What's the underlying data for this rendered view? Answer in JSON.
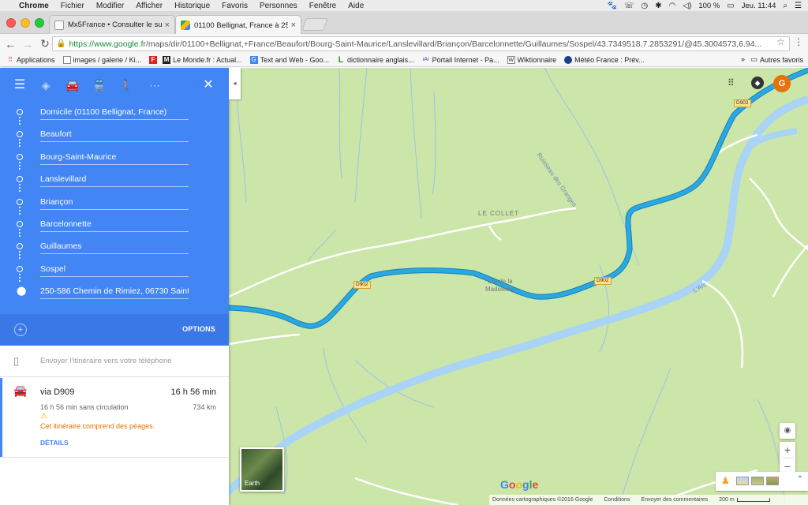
{
  "menubar": {
    "items": [
      "Chrome",
      "Fichier",
      "Modifier",
      "Afficher",
      "Historique",
      "Favoris",
      "Personnes",
      "Fenêtre",
      "Aide"
    ],
    "battery": "100 %",
    "clock": "Jeu. 11:44"
  },
  "tabs": [
    {
      "title": "Mx5France • Consulter le sujet",
      "active": false
    },
    {
      "title": "01100 Bellignat, France à 250",
      "active": true
    }
  ],
  "address_bar": {
    "url_host": "https://www.google.fr",
    "url_path": "/maps/dir/01100+Bellignat,+France/Beaufort/Bourg-Saint-Maurice/Lanslevillard/Briançon/Barcelonnette/Guillaumes/Sospel/43.7349518,7.2853291/@45.3004573,6.94..."
  },
  "bookmarks": {
    "items": [
      {
        "label": "Applications",
        "icon": "apps-grid-icon"
      },
      {
        "label": "images / galerie / Ki...",
        "icon": "page-icon"
      },
      {
        "label": "",
        "icon": "le-monde-f-icon"
      },
      {
        "label": "Le Monde.fr : Actual...",
        "icon": "le-monde-icon"
      },
      {
        "label": "Text and Web - Goo...",
        "icon": "google-translate-icon"
      },
      {
        "label": "dictionnaire anglais...",
        "icon": "l-icon"
      },
      {
        "label": "Portail Internet - Pa...",
        "icon": "portal-icon"
      },
      {
        "label": "Wiktionnaire",
        "icon": "wiktionary-icon"
      },
      {
        "label": "Météo France : Prév...",
        "icon": "meteo-icon"
      }
    ],
    "more": "»",
    "other_folder": "Autres favoris"
  },
  "directions": {
    "stops": [
      "Domicile (01100 Bellignat, France)",
      "Beaufort",
      "Bourg-Saint-Maurice",
      "Lanslevillard",
      "Briançon",
      "Barcelonnette",
      "Guillaumes",
      "Sospel",
      "250-586 Chemin de Rimiez, 06730 Saint"
    ],
    "options_label": "OPTIONS",
    "send_to_phone": "Envoyer l'itinéraire vers votre téléphone",
    "route": {
      "via": "via D909",
      "duration": "16 h 56 min",
      "traffic_note": "16 h 56 min sans circulation",
      "distance": "734 km",
      "warning": "Cet itinéraire comprend des péages.",
      "details": "DÉTAILS"
    }
  },
  "map": {
    "labels": {
      "place": "LE COLLET",
      "stream": "Ruisseau des Granges",
      "pass_line1": "Col de la",
      "pass_line2": "Madeleine",
      "river": "L'Arc"
    },
    "road_badges": [
      "D902",
      "D902",
      "D902"
    ],
    "avatar_letter": "G",
    "earth_label": "Earth",
    "google_logo": "Google",
    "footer": {
      "copyright": "Données cartographiques ©2016 Google",
      "terms": "Conditions",
      "feedback": "Envoyer des commentaires",
      "scale": "200 m"
    }
  },
  "colors": {
    "route": "#29a9e1",
    "map_bg": "#cce5a8",
    "water": "#a9d4f5",
    "header": "#4285f4"
  }
}
